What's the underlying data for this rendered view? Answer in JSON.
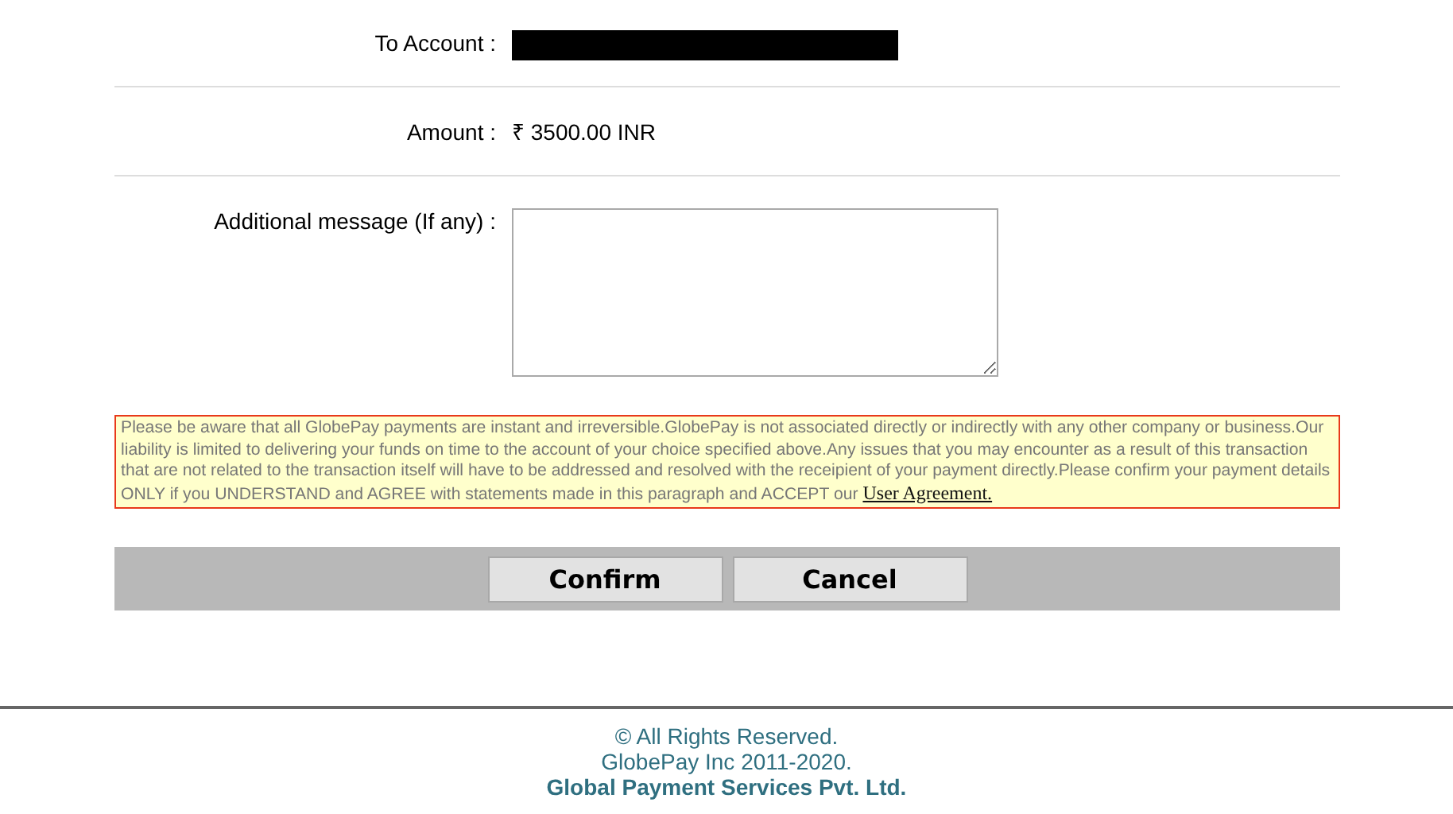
{
  "form": {
    "rows": [
      {
        "kind": "redacted",
        "label": "To Account :"
      },
      {
        "kind": "text",
        "label": "Amount :",
        "value": "₹ 3500.00 INR"
      },
      {
        "kind": "textarea",
        "label": "Additional message (If any) :"
      }
    ]
  },
  "notice": {
    "text": "Please be aware that all GlobePay payments are instant and irreversible.GlobePay is not associated directly or indirectly with any other company or business.Our liability is limited to delivering your funds on time to the account of your choice specified above.Any issues that you may encounter as a result of this transaction that are not related to the transaction itself will have to be addressed and resolved with the receipient of your payment directly.Please confirm your payment details ONLY if you UNDERSTAND and AGREE with statements made in this paragraph and ACCEPT our",
    "link": "User Agreement."
  },
  "buttons": [
    "Confirm",
    "Cancel"
  ],
  "footer": {
    "lines": [
      "© All Rights Reserved.",
      "GlobePay Inc 2011-2020."
    ],
    "company": "Global Payment Services Pvt. Ltd."
  }
}
